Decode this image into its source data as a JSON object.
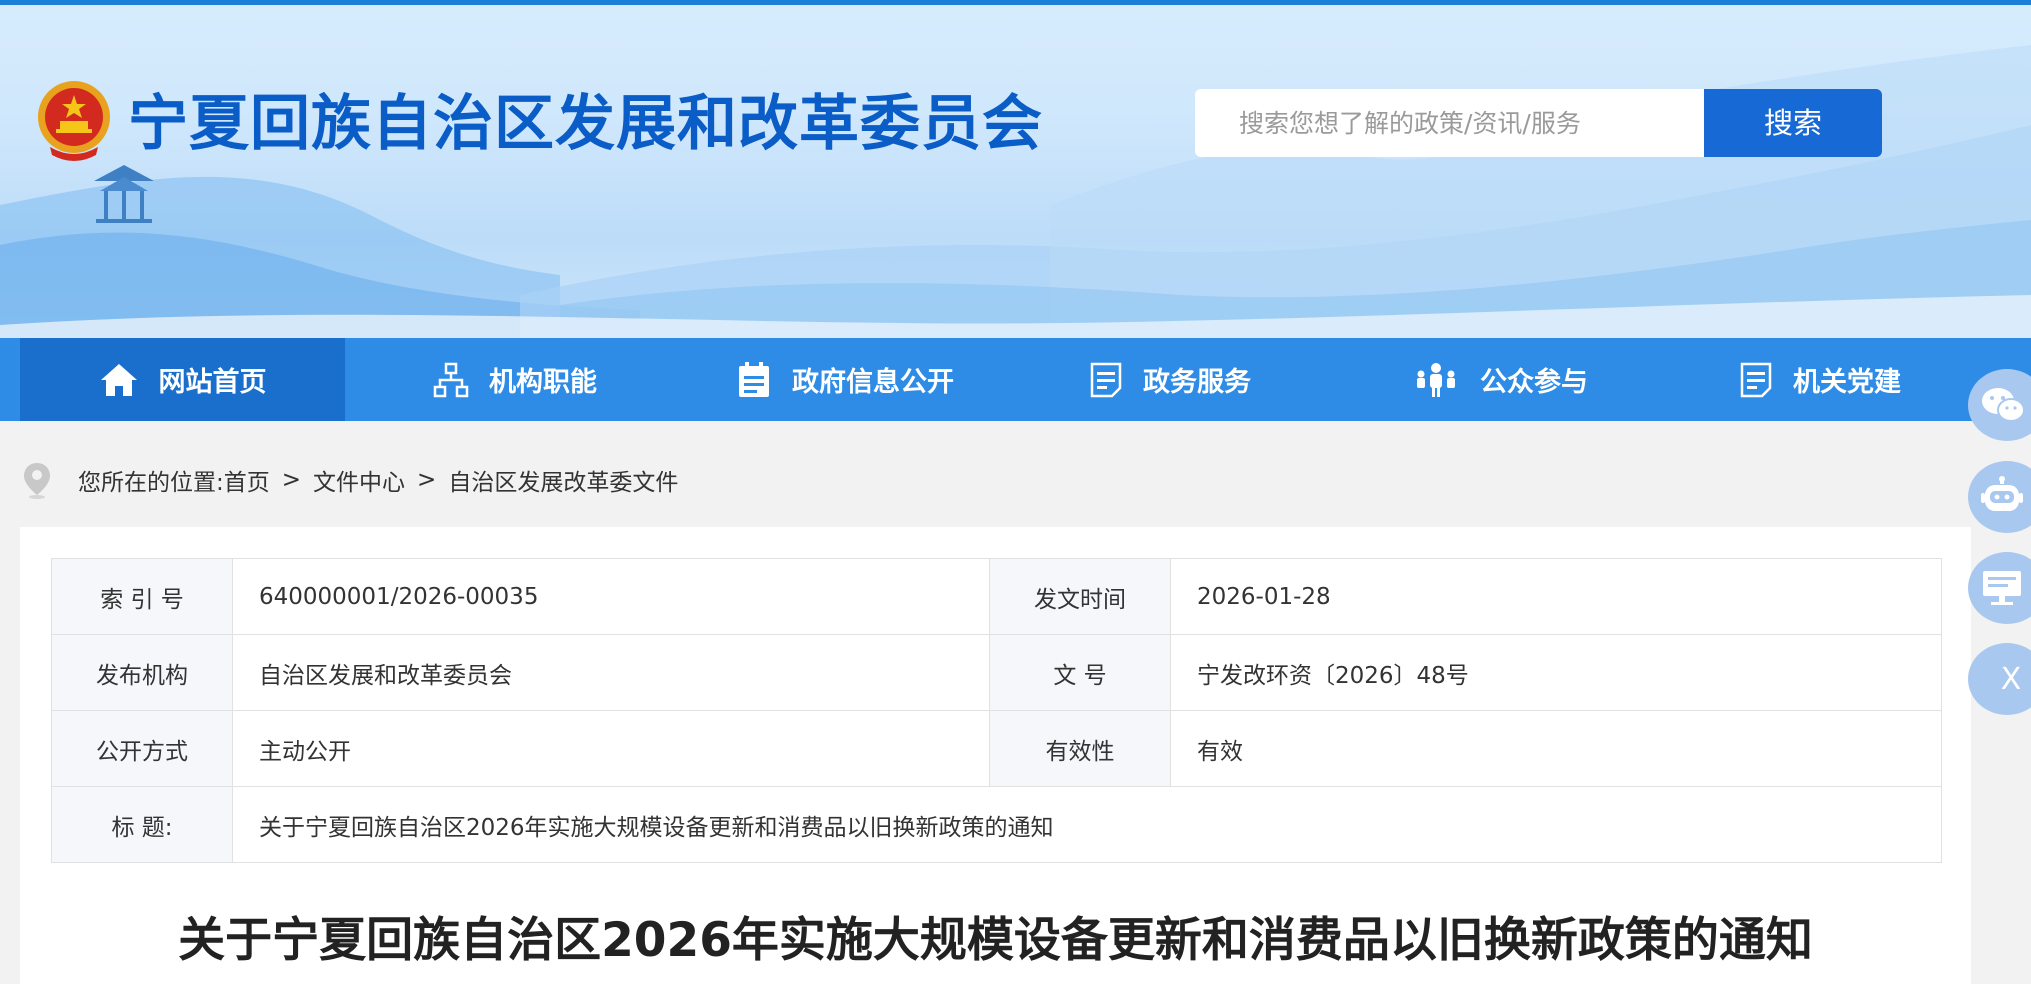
{
  "header": {
    "site_title": "宁夏回族自治区发展和改革委员会",
    "search_placeholder": "搜索您想了解的政策/资讯/服务",
    "search_button": "搜索"
  },
  "nav": [
    {
      "label": "网站首页",
      "icon": "home-icon",
      "active": true
    },
    {
      "label": "机构职能",
      "icon": "org-chart-icon"
    },
    {
      "label": "政府信息公开",
      "icon": "calendar-list-icon"
    },
    {
      "label": "政务服务",
      "icon": "document-icon"
    },
    {
      "label": "公众参与",
      "icon": "people-icon"
    },
    {
      "label": "机关党建",
      "icon": "document-icon"
    }
  ],
  "breadcrumb": {
    "prefix": "您所在的位置:",
    "items": [
      "首页",
      "文件中心",
      "自治区发展改革委文件"
    ],
    "separator": ">"
  },
  "meta": {
    "index_label": "索 引 号",
    "index_value": "640000001/2026-00035",
    "date_label": "发文时间",
    "date_value": "2026-01-28",
    "publisher_label": "发布机构",
    "publisher_value": "自治区发展和改革委员会",
    "docno_label": "文 号",
    "docno_value": "宁发改环资〔2026〕48号",
    "disclosure_label": "公开方式",
    "disclosure_value": "主动公开",
    "validity_label": "有效性",
    "validity_value": "有效",
    "title_label": "标 题:",
    "title_value": "关于宁夏回族自治区2026年实施大规模设备更新和消费品以旧换新政策的通知"
  },
  "document": {
    "title": "关于宁夏回族自治区2026年实施大规模设备更新和消费品以旧换新政策的通知"
  },
  "floating": {
    "close_label": "X",
    "icons": [
      "wechat-icon",
      "robot-icon",
      "monitor-icon",
      "close-icon"
    ]
  },
  "colors": {
    "primary": "#1769d6",
    "nav": "#2e8be6",
    "nav_active": "#1a6fcc",
    "title": "#0a5cc7"
  }
}
